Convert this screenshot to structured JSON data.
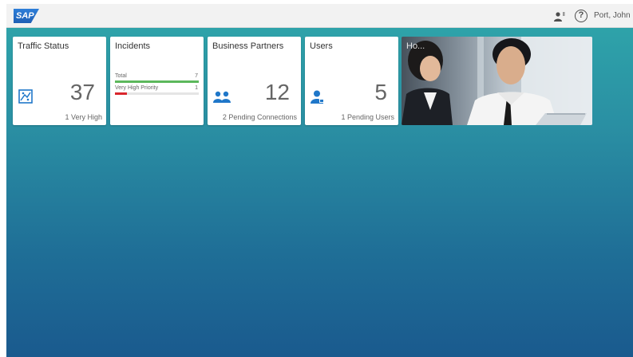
{
  "shell": {
    "logo_text": "SAP",
    "user_name": "Port, John",
    "help_glyph": "?",
    "icons": {
      "user_menu": "user-settings-icon",
      "help": "help-icon"
    }
  },
  "tiles": {
    "traffic": {
      "title": "Traffic Status",
      "number": "37",
      "footer": "1 Very High",
      "icon": "traffic-map-icon"
    },
    "incidents": {
      "title": "Incidents",
      "bars": [
        {
          "label": "Total",
          "value": "7",
          "fraction": 1.0,
          "color": "#5cb85c"
        },
        {
          "label": "Very High Priority",
          "value": "1",
          "fraction": 0.14,
          "color": "#d9262c"
        }
      ]
    },
    "partners": {
      "title": "Business Partners",
      "number": "12",
      "footer": "2 Pending Connections",
      "icon": "group-icon"
    },
    "users": {
      "title": "Users",
      "number": "5",
      "footer": "1 Pending Users",
      "icon": "user-icon"
    },
    "news": {
      "title": "Ho..."
    }
  },
  "colors": {
    "accent_blue": "#1f77c9",
    "shell_background": "#f2f2f2"
  }
}
